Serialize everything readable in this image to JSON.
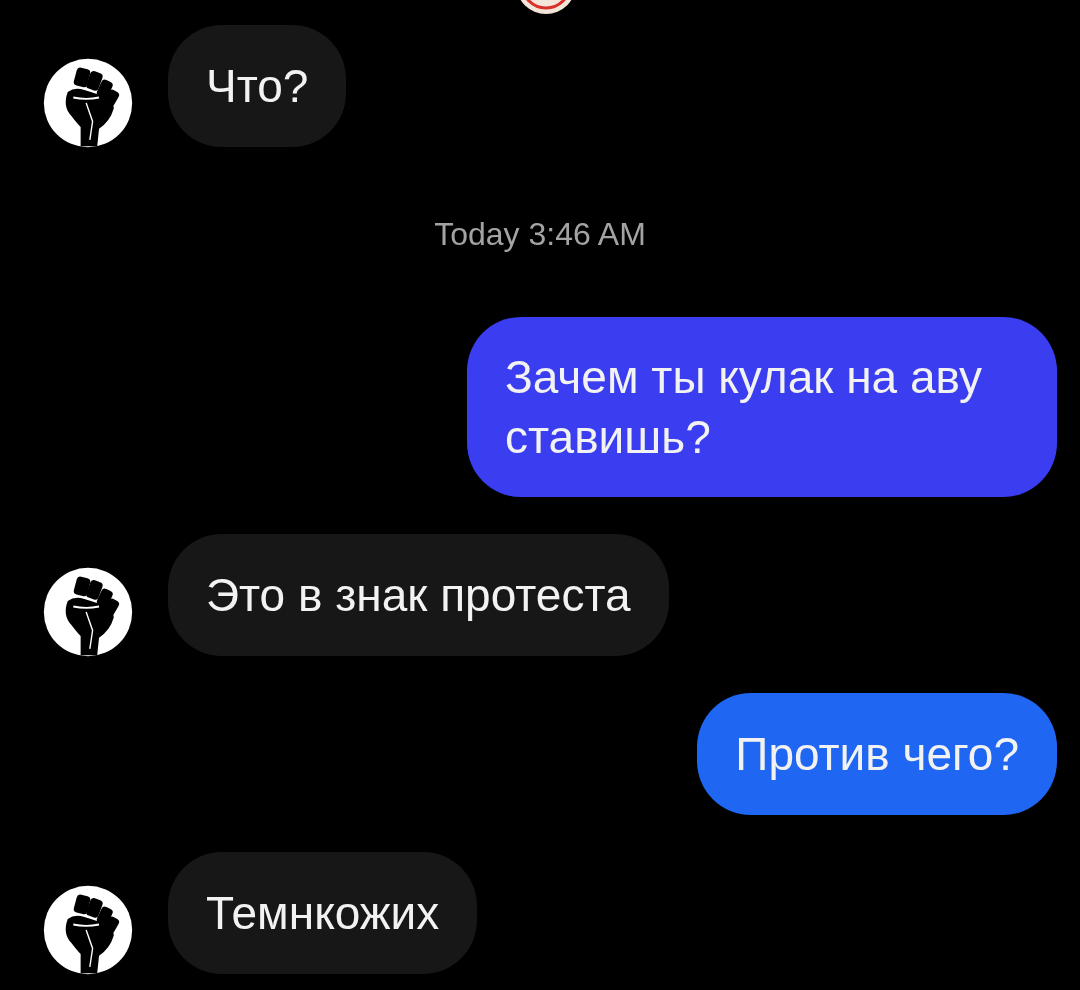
{
  "messages": [
    {
      "kind": "received",
      "text": "Что?",
      "color": "#171717"
    },
    {
      "kind": "timestamp",
      "text": "Today 3:46 AM"
    },
    {
      "kind": "sent",
      "text": "Зачем ты кулак на аву ставишь?",
      "color": "#3a3ef0"
    },
    {
      "kind": "received",
      "text": "Это в знак протеста",
      "color": "#171717"
    },
    {
      "kind": "sent",
      "text": "Против чего?",
      "color": "#1f66f2"
    },
    {
      "kind": "received",
      "text": "Темнкожих",
      "color": "#171717"
    }
  ]
}
